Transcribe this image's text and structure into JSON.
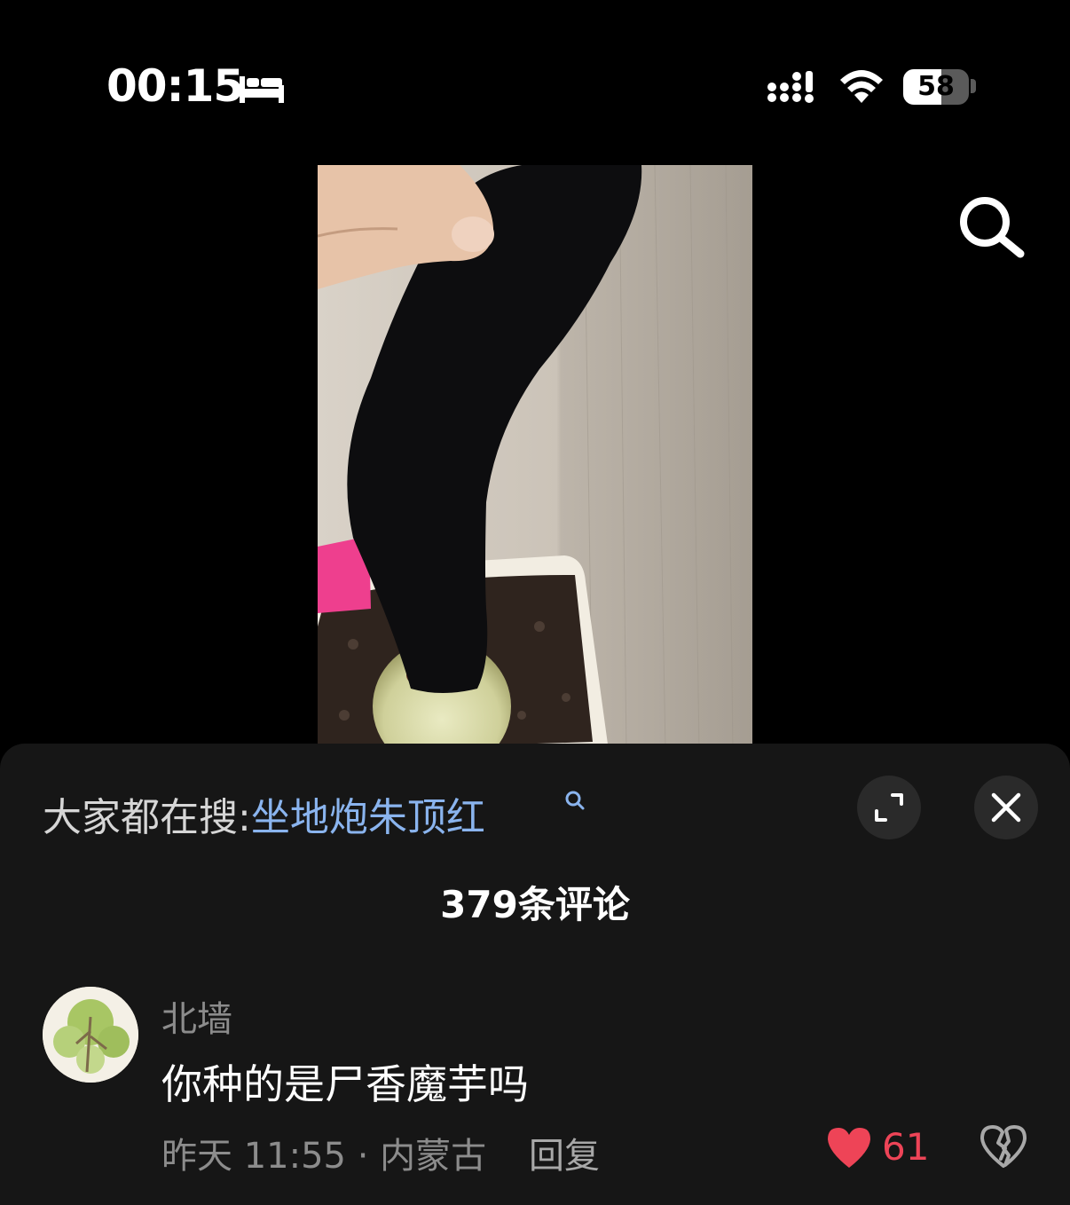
{
  "status_bar": {
    "time": "00:15",
    "battery_level": "58",
    "battery_fill_fraction": 0.58,
    "icons": [
      "bed-icon",
      "cellular-signal-icon",
      "wifi-icon",
      "battery-icon"
    ]
  },
  "video": {
    "content": "video-frame",
    "search_icon": "search-icon"
  },
  "comments_panel": {
    "trending_prefix": "大家都在搜:",
    "trending_query": "坐地炮朱顶红",
    "expand_icon": "expand-icon",
    "close_icon": "close-icon",
    "comment_count_label": "379条评论"
  },
  "comments": [
    {
      "username": "北墙",
      "text": "你种的是尸香魔芋吗",
      "meta": "昨天 11:55 · 内蒙古",
      "reply_label": "回复",
      "like_count": "61",
      "colors": {
        "like": "#ee4457"
      }
    }
  ]
}
